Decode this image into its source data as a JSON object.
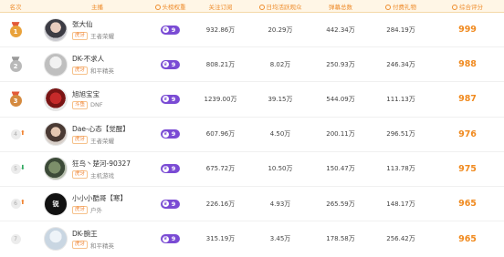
{
  "header": {
    "rank": "名次",
    "anchor": "主播",
    "weight": "头榜权重",
    "followers": "关注订阅",
    "avg_peak": "日均活跃观众",
    "gifts": "弹幕总数",
    "paid": "付费礼物",
    "score": "综合评分"
  },
  "rows": [
    {
      "rank": "1",
      "trend": "",
      "name": "张大仙",
      "platform": "虎牙",
      "category": "王者荣耀",
      "weight": "9",
      "followers": "932.86万",
      "avg": "20.29万",
      "danmu": "442.34万",
      "paid": "284.19万",
      "score": "999"
    },
    {
      "rank": "2",
      "trend": "",
      "name": "DK-不求人",
      "platform": "虎牙",
      "category": "和平精英",
      "weight": "9",
      "followers": "808.21万",
      "avg": "8.02万",
      "danmu": "250.93万",
      "paid": "246.34万",
      "score": "988"
    },
    {
      "rank": "3",
      "trend": "",
      "name": "旭旭宝宝",
      "platform": "斗鱼",
      "category": "DNF",
      "weight": "9",
      "followers": "1239.00万",
      "avg": "39.15万",
      "danmu": "544.09万",
      "paid": "111.13万",
      "score": "987"
    },
    {
      "rank": "4",
      "trend": "up",
      "name": "Dae-心态【觉醒】",
      "platform": "虎牙",
      "category": "王者荣耀",
      "weight": "9",
      "followers": "607.96万",
      "avg": "4.50万",
      "danmu": "200.11万",
      "paid": "296.51万",
      "score": "976"
    },
    {
      "rank": "5",
      "trend": "down",
      "name": "狂鸟丶楚河-90327",
      "platform": "虎牙",
      "category": "主机游戏",
      "weight": "9",
      "followers": "675.72万",
      "avg": "10.50万",
      "danmu": "150.47万",
      "paid": "113.78万",
      "score": "975"
    },
    {
      "rank": "6",
      "trend": "up",
      "name": "小小小酷哥【寒】",
      "platform": "虎牙",
      "category": "户外",
      "weight": "9",
      "followers": "226.16万",
      "avg": "4.93万",
      "danmu": "265.59万",
      "paid": "148.17万",
      "score": "965"
    },
    {
      "rank": "7",
      "trend": "",
      "name": "DK-腕王",
      "platform": "虎牙",
      "category": "和平精英",
      "weight": "9",
      "followers": "315.19万",
      "avg": "3.45万",
      "danmu": "178.58万",
      "paid": "256.42万",
      "score": "965"
    }
  ],
  "icons": {
    "trend_up": "arrow-up-icon",
    "trend_down": "arrow-down-icon",
    "weight": "crown-icon"
  },
  "colors": {
    "accent": "#ee8c2c",
    "score": "#f08a1f",
    "badge": "#7a4bd4"
  }
}
